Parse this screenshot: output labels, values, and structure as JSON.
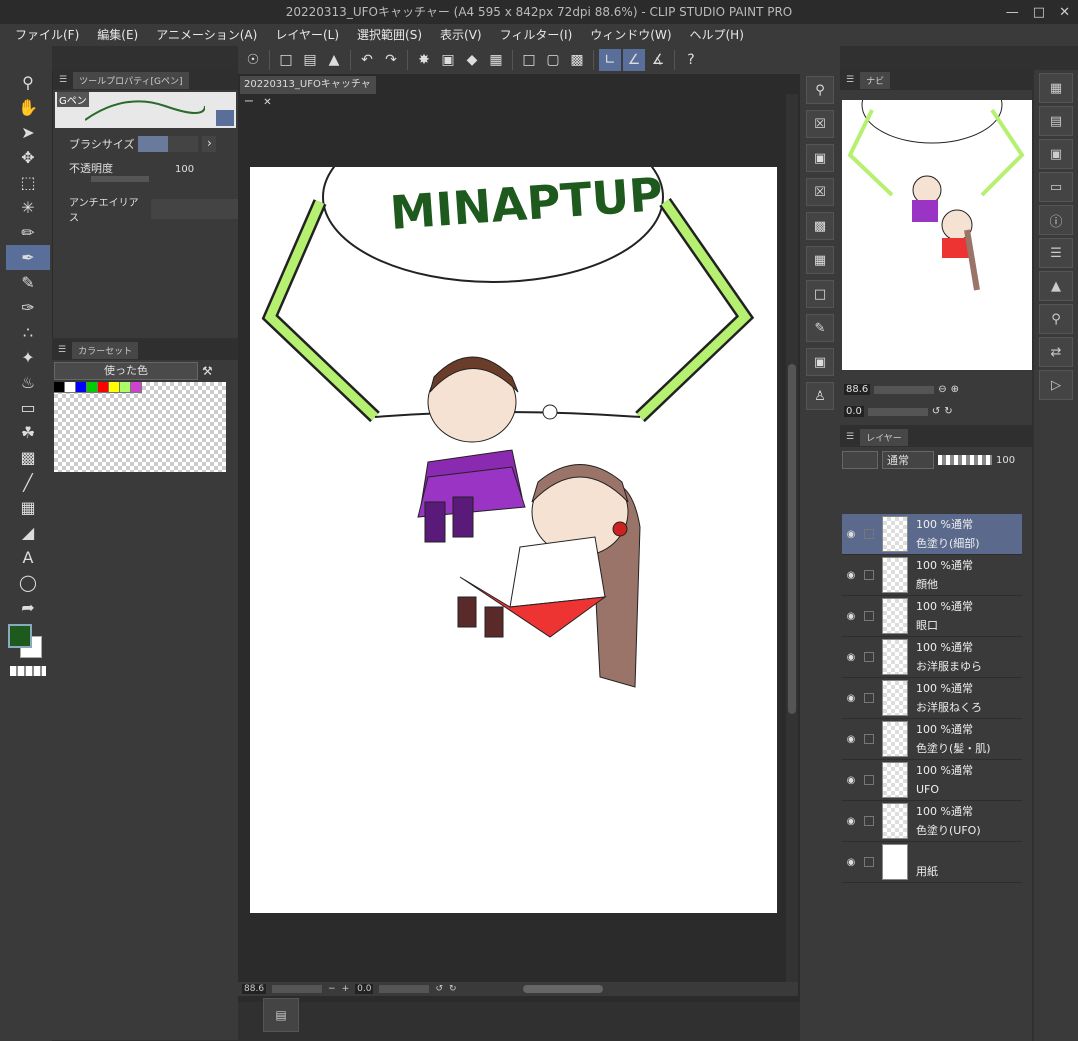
{
  "window": {
    "title": "20220313_UFOキャッチャー (A4 595 x 842px 72dpi 88.6%)  - CLIP STUDIO PAINT PRO"
  },
  "menu": [
    "ファイル(F)",
    "編集(E)",
    "アニメーション(A)",
    "レイヤー(L)",
    "選択範囲(S)",
    "表示(V)",
    "フィルター(I)",
    "ウィンドウ(W)",
    "ヘルプ(H)"
  ],
  "tool_property": {
    "tab": "ツールプロパティ[Gペン]",
    "brush_name": "Gペン",
    "brush_size_label": "ブラシサイズ",
    "opacity_label": "不透明度",
    "opacity_value": "100",
    "antialias_label": "アンチエイリアス"
  },
  "color_set": {
    "tab": "カラーセット",
    "selector": "使った色"
  },
  "document": {
    "tab": "20220313_UFOキャッチャー",
    "text_on_canvas": "MINAPTUP"
  },
  "status": {
    "zoom": "88.6",
    "angle": "0.0"
  },
  "navigator": {
    "tab": "ナビ",
    "zoom": "88.6",
    "angle": "0.0"
  },
  "layer_panel": {
    "tab": "レイヤー",
    "blend_mode": "通常",
    "opacity": "100",
    "layers": [
      {
        "mode": "100 %通常",
        "name": "色塗り(細部)",
        "selected": true
      },
      {
        "mode": "100 %通常",
        "name": "顔他",
        "selected": false
      },
      {
        "mode": "100 %通常",
        "name": "眼口",
        "selected": false
      },
      {
        "mode": "100 %通常",
        "name": "お洋服まゆら",
        "selected": false
      },
      {
        "mode": "100 %通常",
        "name": "お洋服ねくろ",
        "selected": false
      },
      {
        "mode": "100 %通常",
        "name": "色塗り(髪・肌)",
        "selected": false
      },
      {
        "mode": "100 %通常",
        "name": "UFO",
        "selected": false
      },
      {
        "mode": "100 %通常",
        "name": "色塗り(UFO)",
        "selected": false
      },
      {
        "mode": "",
        "name": "用紙",
        "selected": false
      }
    ]
  },
  "colors": {
    "main": "#1e5a1e",
    "sub": "#ffffff",
    "accent": "#5a6e9a"
  }
}
